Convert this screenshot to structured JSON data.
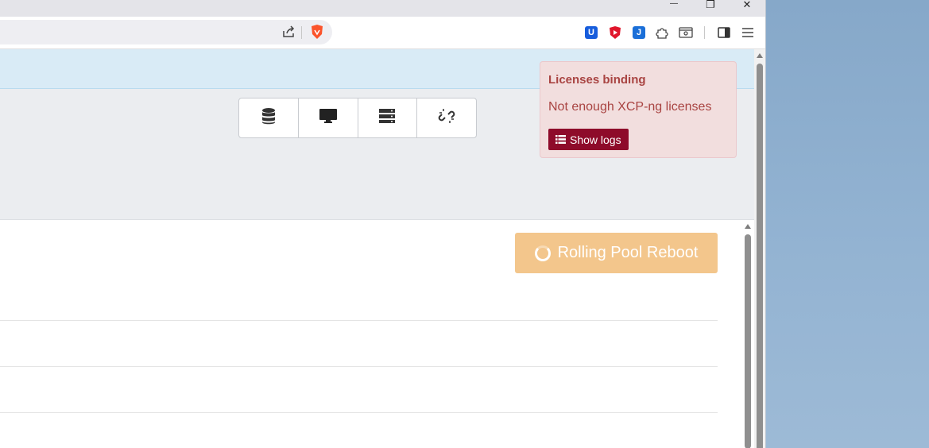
{
  "window": {
    "minimize_glyph": "—",
    "restore_glyph": "❐",
    "close_glyph": "✕"
  },
  "toolbar": {
    "icons": [
      "share-icon",
      "brave-shield-icon",
      "bitwarden-icon",
      "ublock-icon",
      "extension-j-icon",
      "puzzle-extensions-icon",
      "reader-mode-icon",
      "sidebar-toggle-icon",
      "hamburger-menu-icon"
    ],
    "bitwarden_letter": "U",
    "j_letter": "J"
  },
  "nav_buttons": [
    "database-icon",
    "desktop-icon",
    "server-stack-icon",
    "unlink-icon"
  ],
  "notification": {
    "title": "Licenses binding",
    "message": "Not enough XCP-ng licenses",
    "button_label": "Show logs"
  },
  "actions": {
    "rolling_reboot_label": "Rolling Pool Reboot"
  },
  "colors": {
    "accent_warning": "#f3c68c",
    "danger_text": "#a94442",
    "danger_bg": "#f2dede",
    "logs_button": "#8e0b2a",
    "info_strip": "#d9ebf6"
  }
}
